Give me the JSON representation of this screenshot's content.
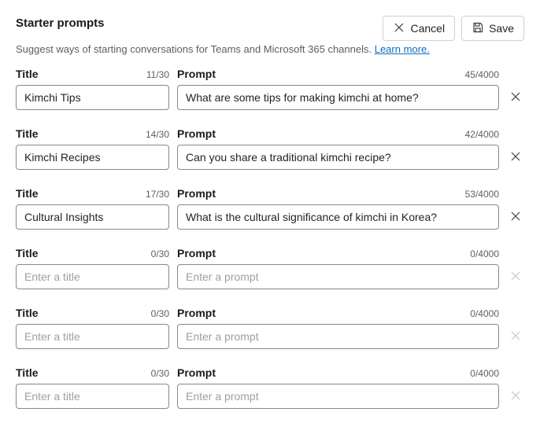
{
  "header": {
    "title": "Starter prompts",
    "subtitle_pre": "Suggest ways of starting conversations for Teams and Microsoft 365 channels. ",
    "learn_more": "Learn more.",
    "cancel": "Cancel",
    "save": "Save"
  },
  "labels": {
    "title": "Title",
    "prompt": "Prompt",
    "title_max": 30,
    "prompt_max": 4000,
    "title_placeholder": "Enter a title",
    "prompt_placeholder": "Enter a prompt"
  },
  "rows": [
    {
      "title": "Kimchi Tips",
      "prompt": "What are some tips for making kimchi at home?",
      "title_len": 11,
      "prompt_len": 45,
      "deletable": true
    },
    {
      "title": "Kimchi Recipes",
      "prompt": "Can you share a traditional kimchi recipe?",
      "title_len": 14,
      "prompt_len": 42,
      "deletable": true
    },
    {
      "title": "Cultural Insights",
      "prompt": "What is the cultural significance of kimchi in Korea?",
      "title_len": 17,
      "prompt_len": 53,
      "deletable": true
    },
    {
      "title": "",
      "prompt": "",
      "title_len": 0,
      "prompt_len": 0,
      "deletable": false
    },
    {
      "title": "",
      "prompt": "",
      "title_len": 0,
      "prompt_len": 0,
      "deletable": false
    },
    {
      "title": "",
      "prompt": "",
      "title_len": 0,
      "prompt_len": 0,
      "deletable": false
    }
  ]
}
